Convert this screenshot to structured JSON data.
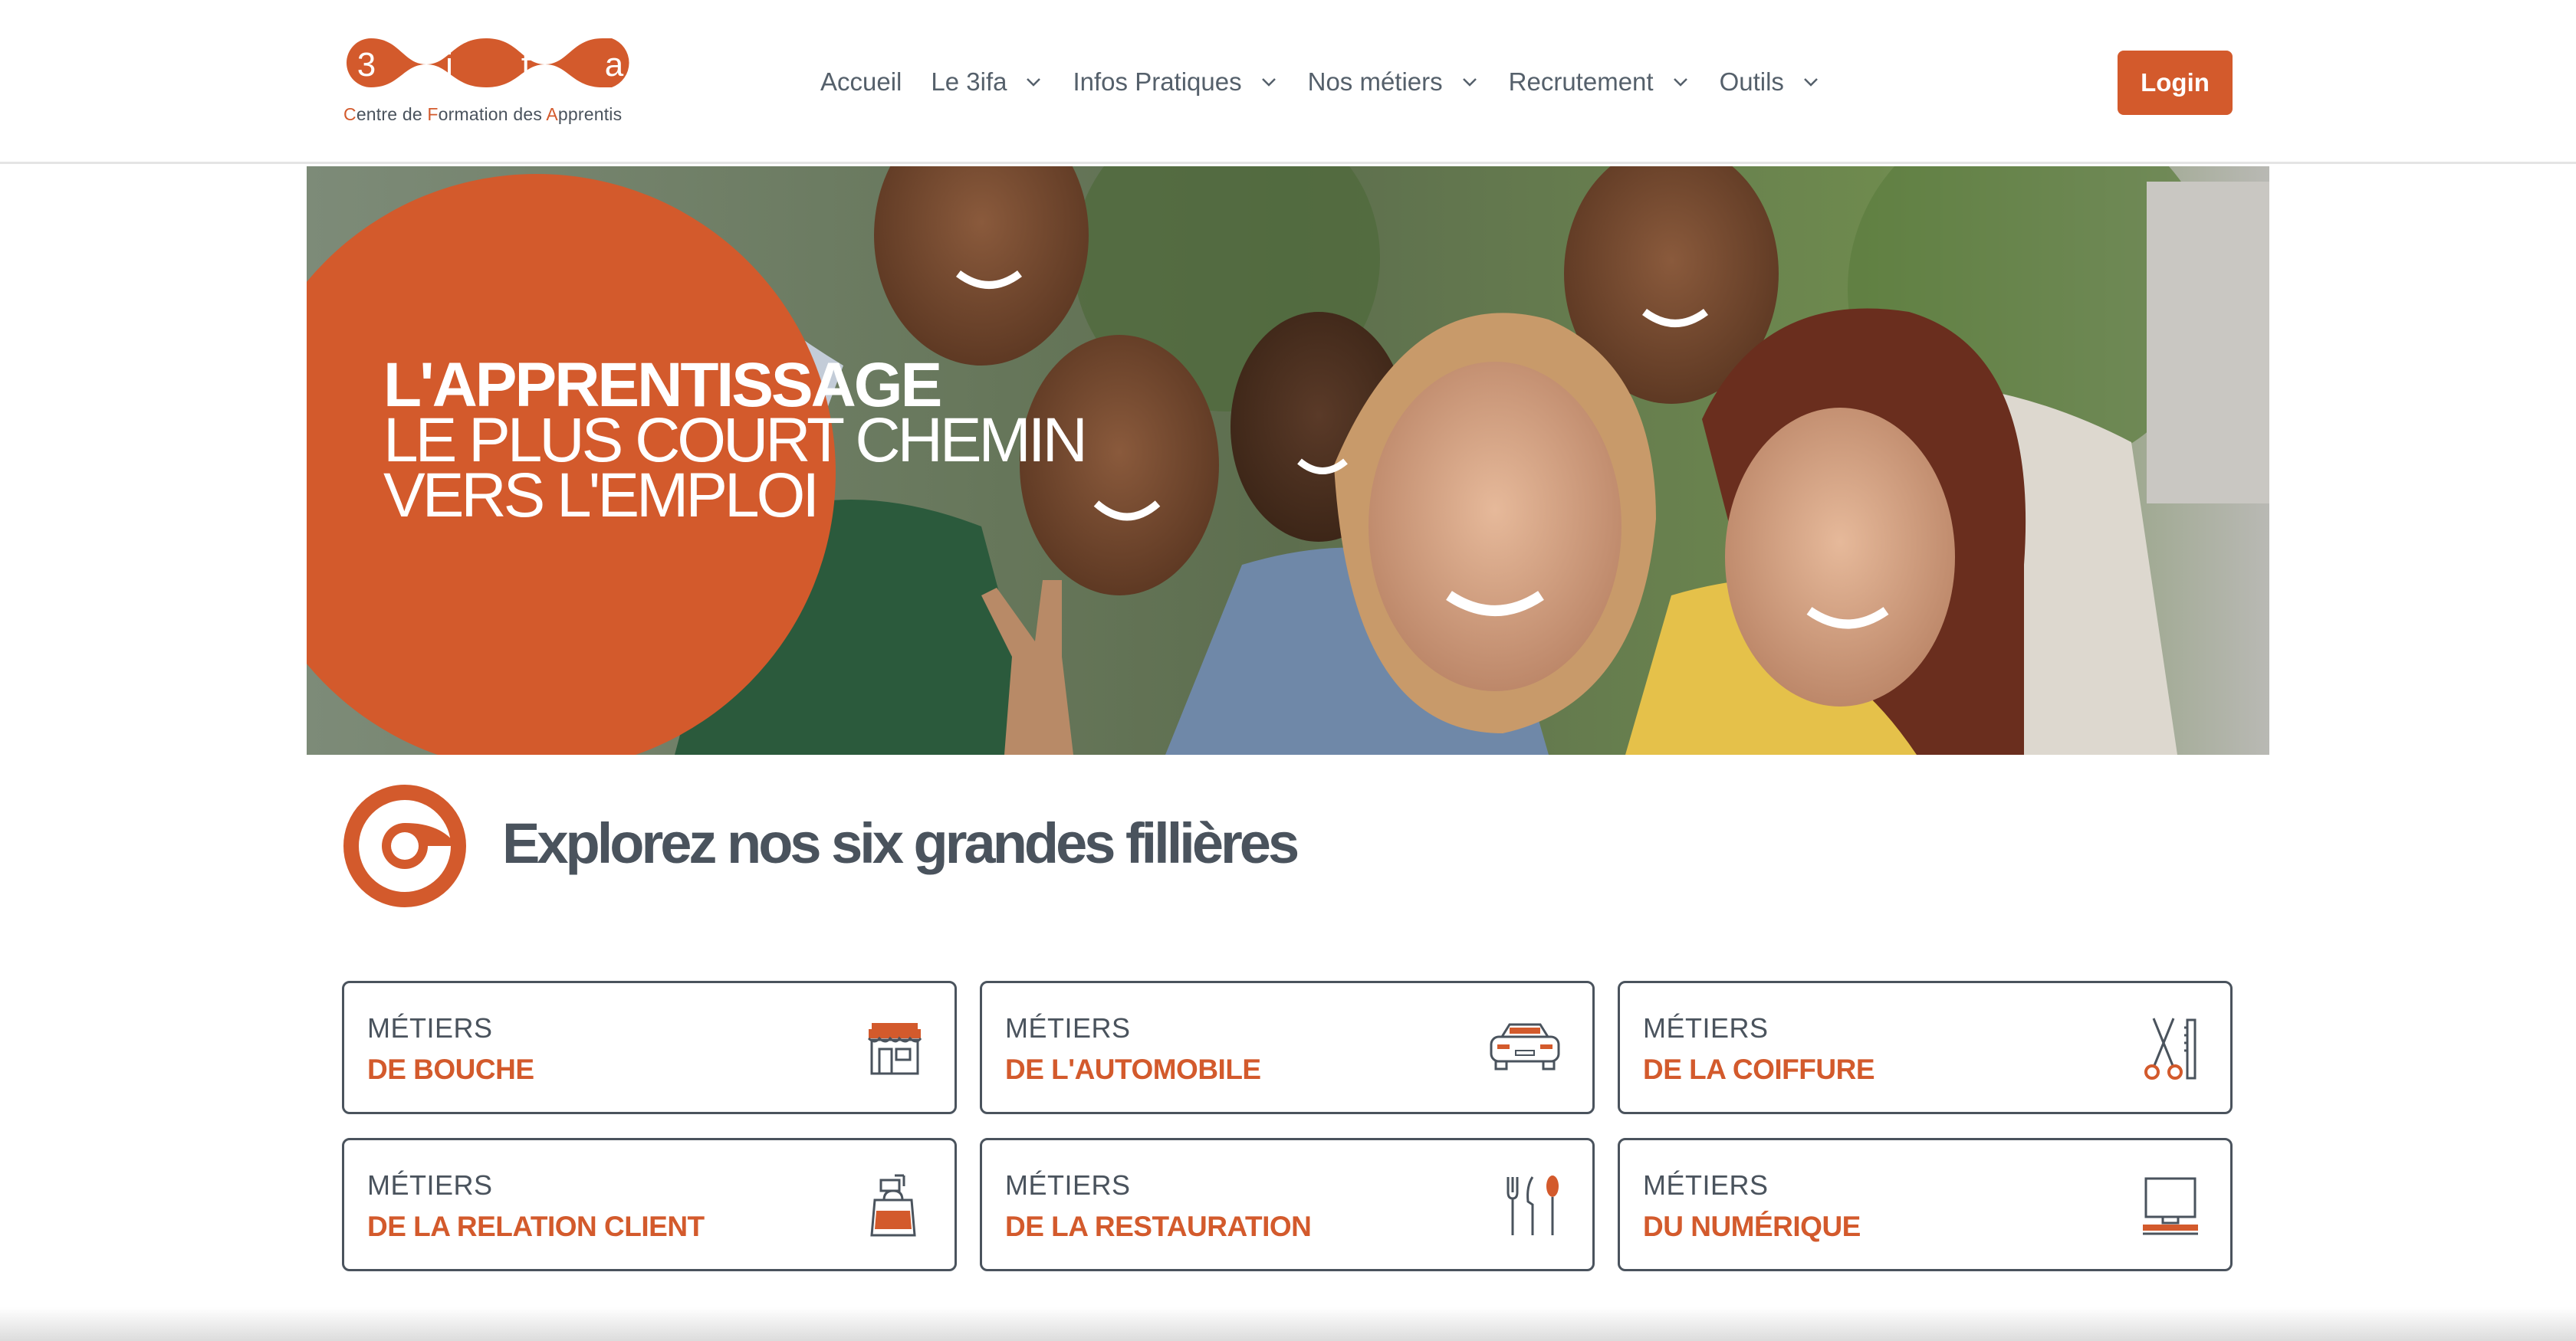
{
  "logo": {
    "letters": [
      "3",
      "i",
      "f",
      "a"
    ],
    "tagline_parts": [
      {
        "text": "C",
        "highlight": true
      },
      {
        "text": "entre de ",
        "highlight": false
      },
      {
        "text": "F",
        "highlight": true
      },
      {
        "text": "ormation des ",
        "highlight": false
      },
      {
        "text": "A",
        "highlight": true
      },
      {
        "text": "pprentis",
        "highlight": false
      }
    ]
  },
  "nav": {
    "items": [
      {
        "label": "Accueil",
        "has_dropdown": false
      },
      {
        "label": "Le 3ifa",
        "has_dropdown": true
      },
      {
        "label": "Infos Pratiques",
        "has_dropdown": true
      },
      {
        "label": "Nos métiers",
        "has_dropdown": true
      },
      {
        "label": "Recrutement",
        "has_dropdown": true
      },
      {
        "label": "Outils",
        "has_dropdown": true
      }
    ],
    "login_label": "Login"
  },
  "hero": {
    "line1": "L'APPRENTISSAGE",
    "line2": "LE PLUS COURT CHEMIN",
    "line3": "VERS L'EMPLOI"
  },
  "section": {
    "title": "Explorez nos six grandes fillières"
  },
  "cards": [
    {
      "pre": "MÉTIERS",
      "main": "DE BOUCHE",
      "icon": "storefront-icon"
    },
    {
      "pre": "MÉTIERS",
      "main": "DE L'AUTOMOBILE",
      "icon": "car-icon"
    },
    {
      "pre": "MÉTIERS",
      "main": "DE LA COIFFURE",
      "icon": "scissors-comb-icon"
    },
    {
      "pre": "MÉTIERS",
      "main": "DE LA RELATION CLIENT",
      "icon": "shopping-bag-icon"
    },
    {
      "pre": "MÉTIERS",
      "main": "DE LA RESTAURATION",
      "icon": "cutlery-icon"
    },
    {
      "pre": "MÉTIERS",
      "main": "DU NUMÉRIQUE",
      "icon": "computer-icon"
    }
  ],
  "colors": {
    "brand_orange": "#d35a2c",
    "text_gray": "#4a535d"
  }
}
